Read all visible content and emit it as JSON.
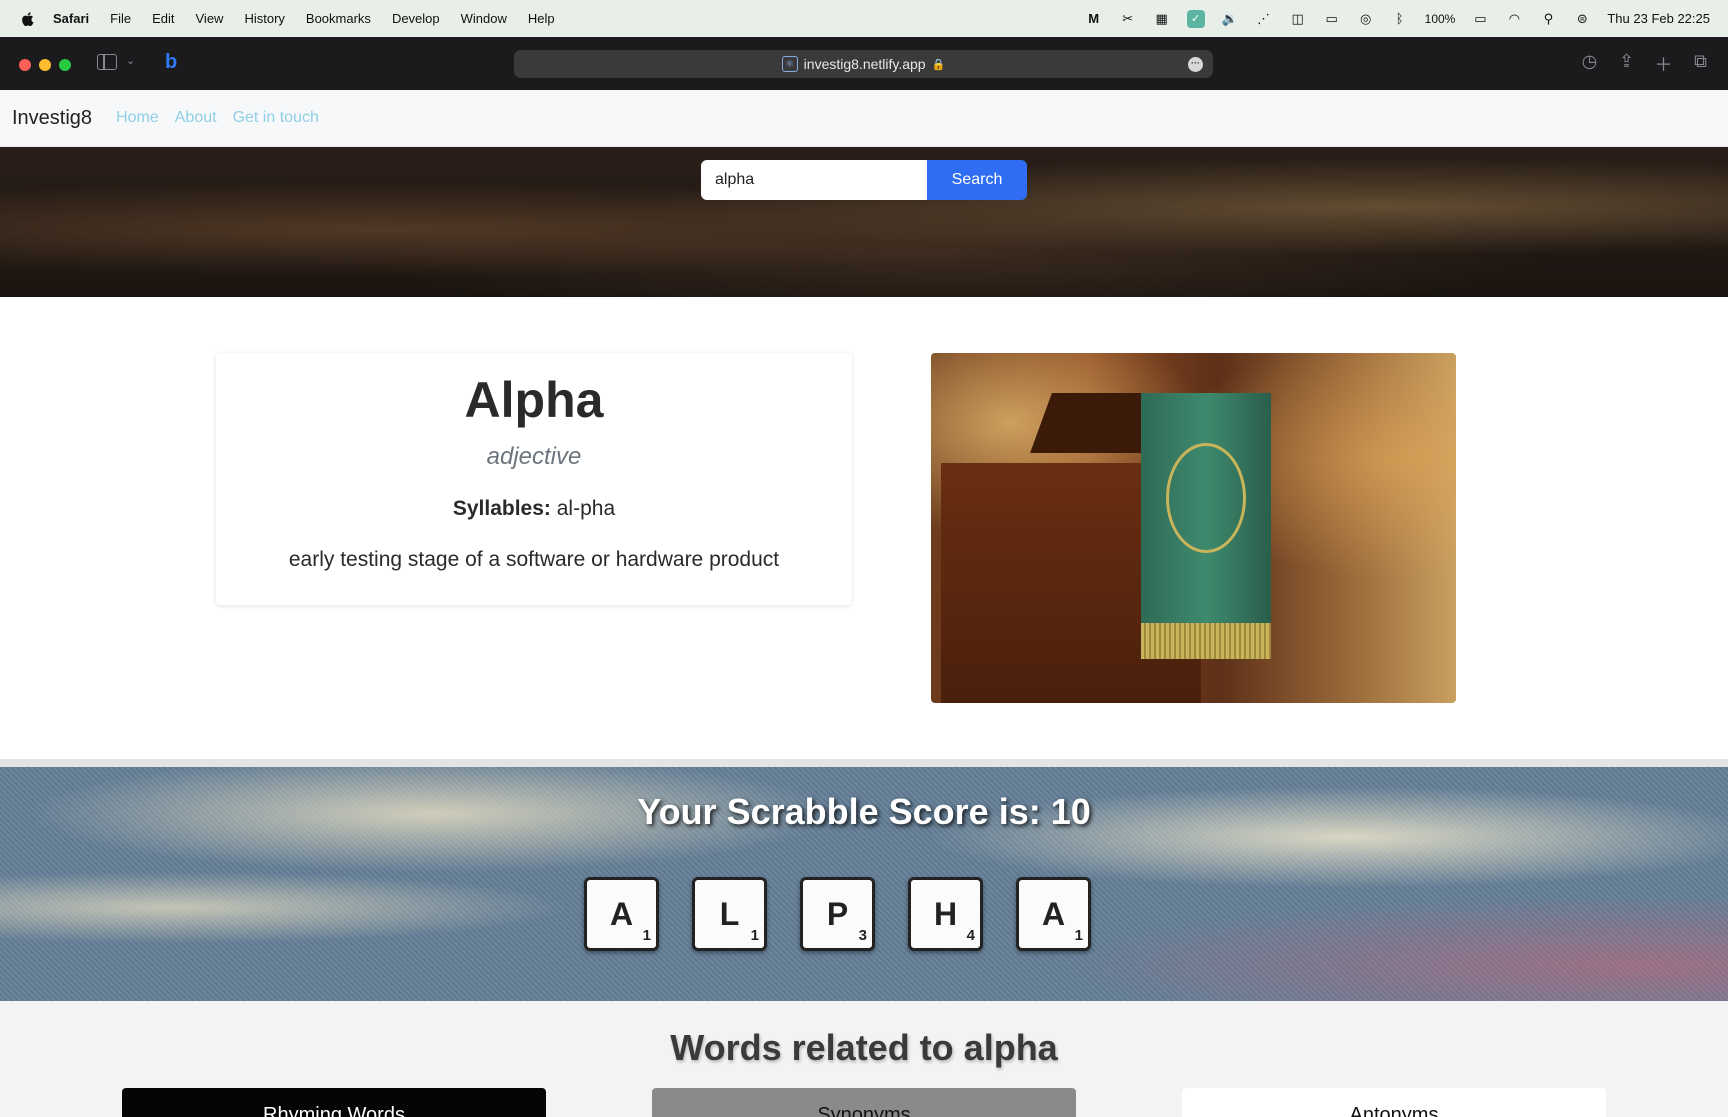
{
  "menubar": {
    "app": "Safari",
    "items": [
      "File",
      "Edit",
      "View",
      "History",
      "Bookmarks",
      "Develop",
      "Window",
      "Help"
    ],
    "battery": "100%",
    "datetime": "Thu 23 Feb  22:25"
  },
  "browser": {
    "url": "investig8.netlify.app"
  },
  "site": {
    "brand": "Investig8",
    "nav": [
      "Home",
      "About",
      "Get in touch"
    ]
  },
  "search": {
    "value": "alpha",
    "button": "Search"
  },
  "word": {
    "title": "Alpha",
    "part_of_speech": "adjective",
    "syllables_label": "Syllables:",
    "syllables": "al-pha",
    "definition": "early testing stage of a software or hardware product"
  },
  "scrabble": {
    "title": "Your Scrabble Score is: 10",
    "tiles": [
      {
        "letter": "A",
        "points": "1"
      },
      {
        "letter": "L",
        "points": "1"
      },
      {
        "letter": "P",
        "points": "3"
      },
      {
        "letter": "H",
        "points": "4"
      },
      {
        "letter": "A",
        "points": "1"
      }
    ]
  },
  "related": {
    "title": "Words related to alpha",
    "tabs": [
      "Rhyming Words",
      "Synonyms",
      "Antonyms"
    ]
  },
  "colors": {
    "search_button": "#2f6ef2",
    "nav_link": "#8fcfe4",
    "rhyming_tab": "#050505",
    "synonyms_tab": "#8a8a8a",
    "antonyms_tab": "#ffffff"
  }
}
